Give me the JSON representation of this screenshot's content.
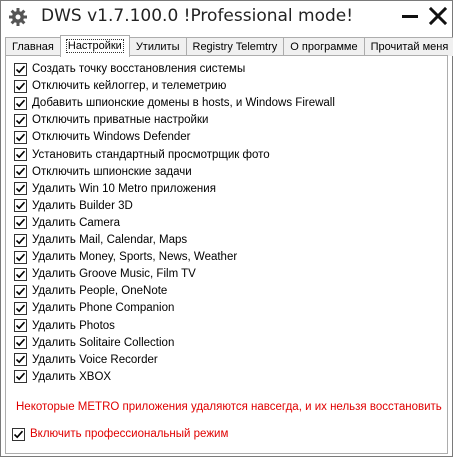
{
  "window": {
    "title": "DWS v1.7.100.0  !Professional mode!"
  },
  "tabs": [
    {
      "label": "Главная",
      "active": false
    },
    {
      "label": "Настройки",
      "active": true
    },
    {
      "label": "Утилиты",
      "active": false
    },
    {
      "label": "Registry Telemtry",
      "active": false
    },
    {
      "label": "О программе",
      "active": false
    },
    {
      "label": "Прочитай меня",
      "active": false
    }
  ],
  "options": [
    {
      "label": "Создать точку восстановления системы",
      "checked": true
    },
    {
      "label": "Отключить кейлоггер, и телеметрию",
      "checked": true
    },
    {
      "label": "Добавить шпионские домены в hosts, и Windows Firewall",
      "checked": true
    },
    {
      "label": "Отключить приватные настройки",
      "checked": true
    },
    {
      "label": "Отключить Windows Defender",
      "checked": true
    },
    {
      "label": "Установить стандартный просмотрщик фото",
      "checked": true
    },
    {
      "label": "Отключить шпионские задачи",
      "checked": true
    },
    {
      "label": "Удалить Win 10 Metro приложения",
      "checked": true
    },
    {
      "label": "Удалить Builder 3D",
      "checked": true
    },
    {
      "label": "Удалить Camera",
      "checked": true
    },
    {
      "label": "Удалить Mail, Calendar, Maps",
      "checked": true
    },
    {
      "label": "Удалить Money, Sports, News, Weather",
      "checked": true
    },
    {
      "label": "Удалить Groove Music, Film TV",
      "checked": true
    },
    {
      "label": "Удалить People, OneNote",
      "checked": true
    },
    {
      "label": "Удалить Phone Companion",
      "checked": true
    },
    {
      "label": "Удалить Photos",
      "checked": true
    },
    {
      "label": "Удалить Solitaire Collection",
      "checked": true
    },
    {
      "label": "Удалить Voice Recorder",
      "checked": true
    },
    {
      "label": "Удалить XBOX",
      "checked": true
    }
  ],
  "warning_text": "Некоторые METRO приложения удаляются навсегда, и их нельзя восстановить",
  "professional_mode": {
    "label": "Включить профессиональный режим",
    "checked": true
  },
  "colors": {
    "warning": "#e00000",
    "text": "#000000",
    "border": "#adadad"
  },
  "icons": {
    "app": "gear-icon",
    "minimize": "minimize-icon",
    "close": "close-icon",
    "check": "checkmark-icon"
  }
}
